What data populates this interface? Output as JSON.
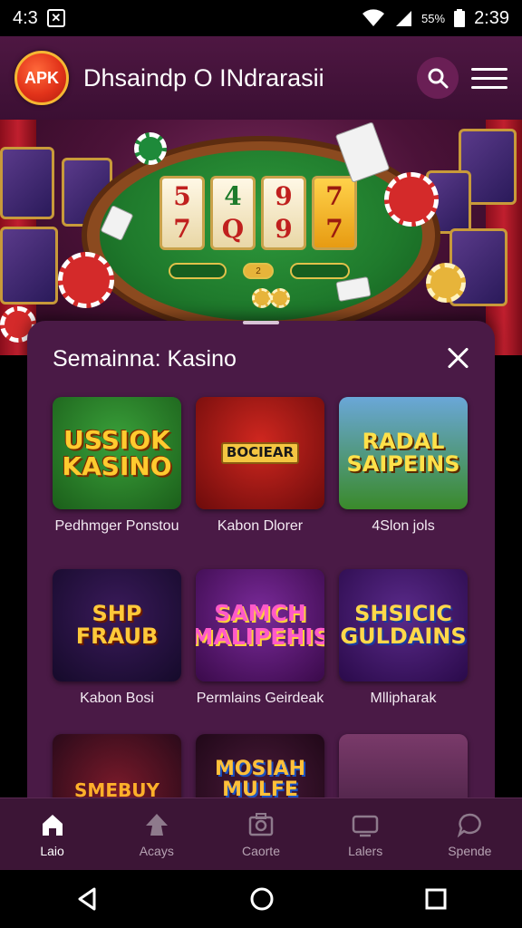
{
  "status_bar": {
    "left_time": "4:3",
    "right_time": "2:39",
    "battery_text": "55%"
  },
  "header": {
    "logo_text": "APK",
    "title": "Dhsaindp O INdrarasii"
  },
  "hero": {
    "reel_top": [
      "5",
      "4",
      "9",
      "7"
    ],
    "reel_bottom": [
      "7",
      "Q",
      "9",
      "7"
    ],
    "center_pill": "2"
  },
  "sheet": {
    "title": "Semainna: Kasino",
    "games": [
      {
        "art_text": "USSIOK KASINO",
        "label": "Pedhmger Ponstou"
      },
      {
        "art_text": "BOCIEAR",
        "label": "Kabon Dlorer"
      },
      {
        "art_text": "RADAL SAIPEINS",
        "label": "4Slon jols"
      },
      {
        "art_text": "SHP FRAUB",
        "label": "Kabon Bosi"
      },
      {
        "art_text": "SAMCH MALIPEHIS",
        "label": "Permlains Geirdeak"
      },
      {
        "art_text": "SHSICIC GULDAINS",
        "label": "Mllipharak"
      },
      {
        "art_text": "SMEBUY",
        "label": ""
      },
      {
        "art_text": "MOSIAH MULFE HAUS",
        "label": ""
      },
      {
        "art_text": "",
        "label": ""
      }
    ]
  },
  "bottom_nav": [
    {
      "label": "Laio",
      "icon": "home-icon",
      "active": true
    },
    {
      "label": "Acays",
      "icon": "spade-icon",
      "active": false
    },
    {
      "label": "Caorte",
      "icon": "camera-icon",
      "active": false
    },
    {
      "label": "Lalers",
      "icon": "tv-icon",
      "active": false
    },
    {
      "label": "Spende",
      "icon": "chat-icon",
      "active": false
    }
  ],
  "colors": {
    "header_bg": "#4e1742",
    "sheet_bg": "#4a1a46",
    "nav_bg": "#3c1536",
    "logo_red": "#e2331a",
    "felt_green": "#1f7a2c"
  }
}
